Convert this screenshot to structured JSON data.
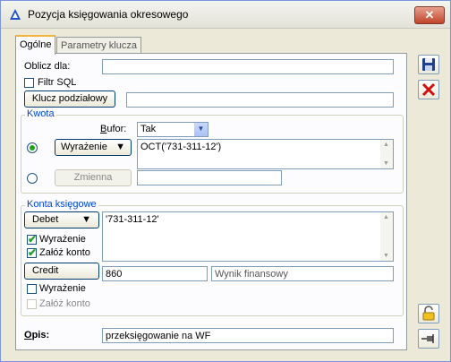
{
  "window": {
    "title": "Pozycja księgowania okresowego"
  },
  "tabs": [
    {
      "label": "Ogólne"
    },
    {
      "label": "Parametry klucza"
    }
  ],
  "general": {
    "oblicz_label": "Oblicz dla:",
    "oblicz_value": "",
    "filtr_sql_label": "Filtr SQL",
    "klucz_button": "Klucz podziałowy",
    "klucz_value": ""
  },
  "kwota": {
    "legend": "Kwota",
    "bufor_label": "Bufor:",
    "bufor_value": "Tak",
    "wyrazenie_button": "Wyrażenie",
    "wyrazenie_value": "OCT('731-311-12')",
    "zmienna_button": "Zmienna",
    "zmienna_value": ""
  },
  "konta": {
    "legend": "Konta księgowe",
    "debet_button": "Debet",
    "debet_value": "'731-311-12'",
    "debet_wyrazenie_label": "Wyrażenie",
    "debet_zaloz_label": "Załóż konto",
    "credit_button": "Credit",
    "credit_value": "860",
    "credit_name": "Wynik finansowy",
    "credit_wyrazenie_label": "Wyrażenie",
    "credit_zaloz_label": "Załóż konto"
  },
  "opis": {
    "label": "Opis:",
    "value": "przeksięgowanie na WF"
  },
  "colors": {
    "accent": "#0046d5",
    "check": "#21a121",
    "tab_highlight": "#f3b33d"
  }
}
